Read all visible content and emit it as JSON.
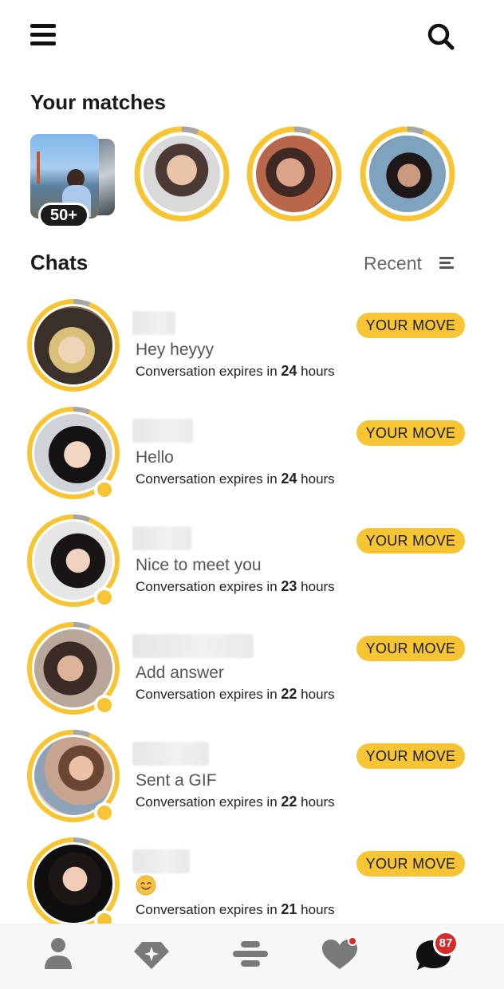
{
  "header": {
    "menu_icon": "hamburger-menu-icon",
    "search_icon": "search-icon"
  },
  "matches": {
    "title": "Your matches",
    "stack_count": "50+",
    "ring_color": "#f7c534"
  },
  "chats": {
    "title": "Chats",
    "sort_label": "Recent",
    "sort_icon": "sort-lines-icon",
    "badge_label": "YOUR MOVE",
    "items": [
      {
        "message": "Hey heyyy",
        "expires_prefix": "Conversation expires in",
        "expires_value": "24",
        "expires_unit": "hours",
        "online": false
      },
      {
        "message": "Hello",
        "expires_prefix": "Conversation expires in",
        "expires_value": "24",
        "expires_unit": "hours",
        "online": true
      },
      {
        "message": "Nice to meet you",
        "expires_prefix": "Conversation expires in",
        "expires_value": "23",
        "expires_unit": "hours",
        "online": true
      },
      {
        "message": "Add answer",
        "expires_prefix": "Conversation expires in",
        "expires_value": "22",
        "expires_unit": "hours",
        "online": true
      },
      {
        "message": "Sent a GIF",
        "expires_prefix": "Conversation expires in",
        "expires_value": "22",
        "expires_unit": "hours",
        "online": true
      },
      {
        "message": "",
        "message_icon": "smiling-emoji-icon",
        "expires_prefix": "Conversation expires in",
        "expires_value": "21",
        "expires_unit": "hours",
        "online": true
      }
    ]
  },
  "bottom_nav": {
    "items": [
      "profile-icon",
      "premium-diamond-icon",
      "discover-stack-icon",
      "liked-you-heart-icon",
      "chats-bubble-icon"
    ],
    "chat_badge": "87"
  },
  "colors": {
    "accent": "#f7c534",
    "badge_red": "#d62b2b"
  }
}
